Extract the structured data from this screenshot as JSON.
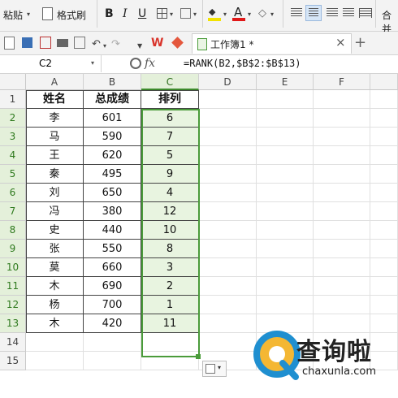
{
  "ribbon": {
    "paste_label": "粘贴",
    "format_painter_label": "格式刷",
    "bold": "B",
    "italic": "I",
    "underline": "U",
    "font_color_glyph": "A",
    "merge_label": "合并"
  },
  "tabbar": {
    "workbook_tab": "工作簿1 *",
    "close_glyph": "×",
    "new_tab_glyph": "+"
  },
  "formula_bar": {
    "cell_ref": "C2",
    "fx_label": "fx",
    "formula": "=RANK(B2,$B$2:$B$13)"
  },
  "columns": [
    "A",
    "B",
    "C",
    "D",
    "E",
    "F"
  ],
  "rows": [
    "1",
    "2",
    "3",
    "4",
    "5",
    "6",
    "7",
    "8",
    "9",
    "10",
    "11",
    "12",
    "13",
    "14",
    "15"
  ],
  "table": {
    "headers": [
      "姓名",
      "总成绩",
      "排列"
    ],
    "data": [
      [
        "李",
        "601",
        "6"
      ],
      [
        "马",
        "590",
        "7"
      ],
      [
        "王",
        "620",
        "5"
      ],
      [
        "秦",
        "495",
        "9"
      ],
      [
        "刘",
        "650",
        "4"
      ],
      [
        "冯",
        "380",
        "12"
      ],
      [
        "史",
        "440",
        "10"
      ],
      [
        "张",
        "550",
        "8"
      ],
      [
        "莫",
        "660",
        "3"
      ],
      [
        "木",
        "690",
        "2"
      ],
      [
        "杨",
        "700",
        "1"
      ],
      [
        "木",
        "420",
        "11"
      ]
    ]
  },
  "watermark": {
    "brand": "查询啦",
    "url": "chaxunla.com"
  },
  "colors": {
    "accent_green": "#4a9b3a",
    "selection_fill": "#e8f4e0",
    "wps_red": "#d9342b"
  }
}
